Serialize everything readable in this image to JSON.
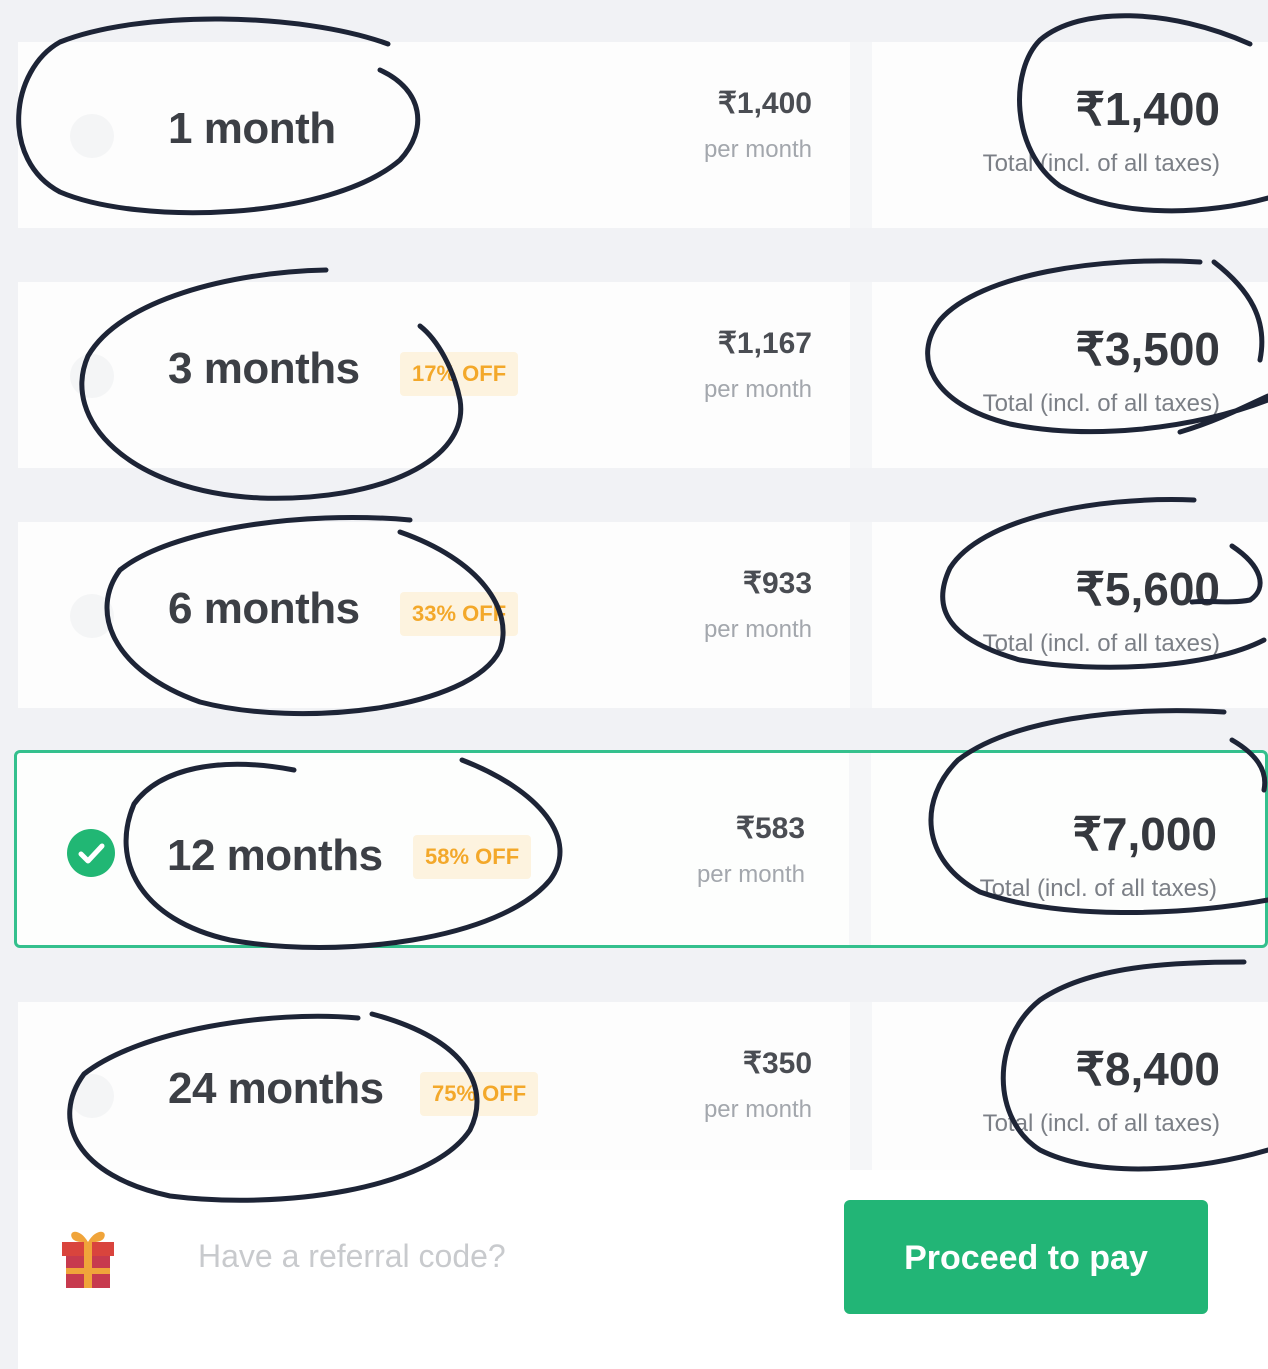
{
  "plans": [
    {
      "duration": "1 month",
      "badge": "",
      "per_month_price": "₹1,400",
      "per_month_label": "per month",
      "total_price": "₹1,400",
      "total_label": "Total (incl. of all taxes)",
      "selected": false
    },
    {
      "duration": "3 months",
      "badge": "17% OFF",
      "per_month_price": "₹1,167",
      "per_month_label": "per month",
      "total_price": "₹3,500",
      "total_label": "Total (incl. of all taxes)",
      "selected": false
    },
    {
      "duration": "6 months",
      "badge": "33% OFF",
      "per_month_price": "₹933",
      "per_month_label": "per month",
      "total_price": "₹5,600",
      "total_label": "Total (incl. of all taxes)",
      "selected": false
    },
    {
      "duration": "12 months",
      "badge": "58% OFF",
      "per_month_price": "₹583",
      "per_month_label": "per month",
      "total_price": "₹7,000",
      "total_label": "Total (incl. of all taxes)",
      "selected": true
    },
    {
      "duration": "24 months",
      "badge": "75% OFF",
      "per_month_price": "₹350",
      "per_month_label": "per month",
      "total_price": "₹8,400",
      "total_label": "Total (incl. of all taxes)",
      "selected": false
    }
  ],
  "footer": {
    "gift_icon": "gift-icon",
    "referral_prompt": "Have a referral code?",
    "proceed_label": "Proceed to pay"
  },
  "colors": {
    "accent_green": "#22b576",
    "selected_border": "#34c08d",
    "discount_badge_bg": "#fdf3df",
    "discount_badge_text": "#f3a82a",
    "annotation_ink": "#1d2436"
  }
}
